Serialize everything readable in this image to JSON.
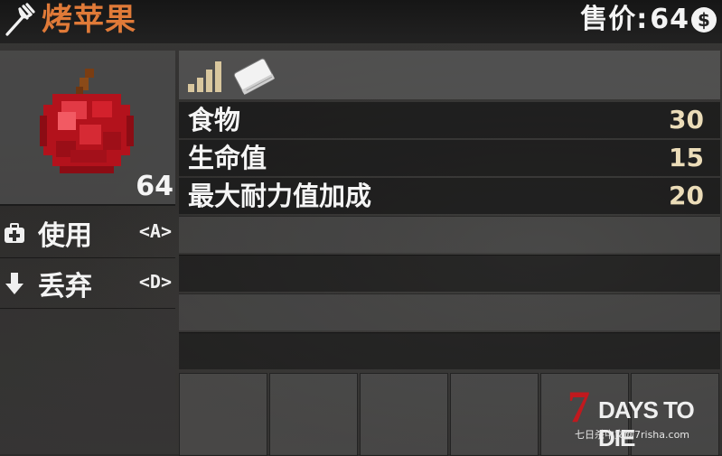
{
  "header": {
    "title": "烤苹果",
    "price_label": "售价:",
    "price_value": "64",
    "currency_icon": "dollar-coin-icon",
    "category_icon": "fork-icon"
  },
  "item": {
    "icon": "apple-icon",
    "count": "64"
  },
  "actions": [
    {
      "label": "使用",
      "key": "<A>",
      "icon": "first-aid-kit-icon"
    },
    {
      "label": "丢弃",
      "key": "<D>",
      "icon": "arrow-down-icon"
    }
  ],
  "stats_header": {
    "tier_icon": "tier-bars-icon",
    "book_icon": "book-icon"
  },
  "stats": [
    {
      "label": "食物",
      "value": "30"
    },
    {
      "label": "生命值",
      "value": "15"
    },
    {
      "label": "最大耐力值加成",
      "value": "20"
    }
  ],
  "watermark": {
    "logo_number": "7",
    "logo_text": "DAYS TO DIE",
    "subtitle": "七日杀中文网7risha.com"
  },
  "colors": {
    "title": "#e07a38",
    "stat_value": "#ebdcb8",
    "logo_red": "#c0191e"
  }
}
